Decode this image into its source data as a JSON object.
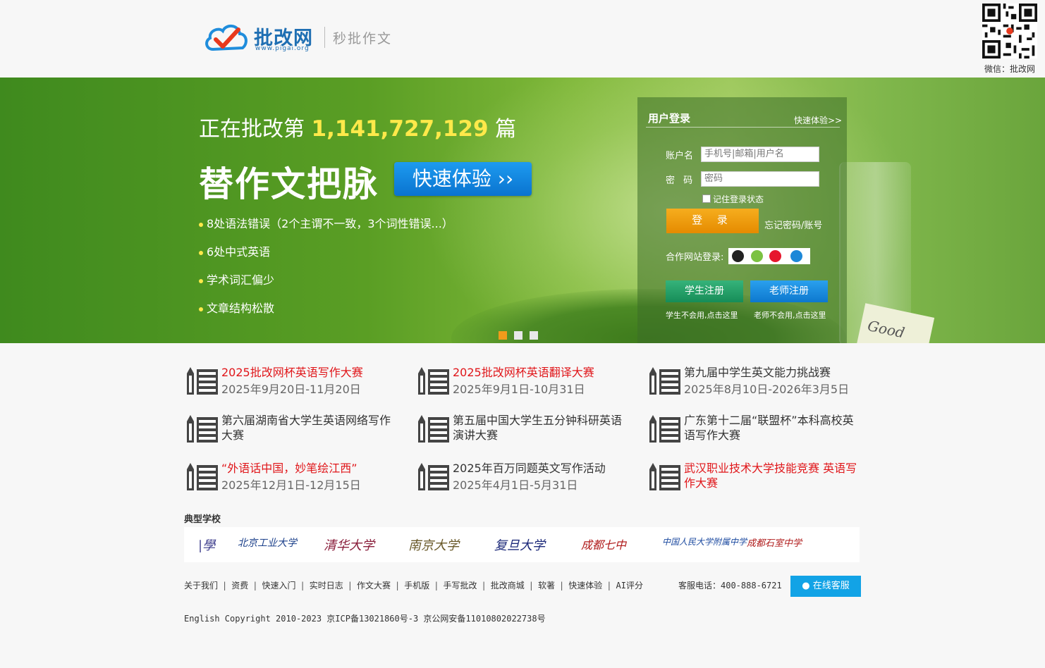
{
  "header": {
    "brand": "批改网",
    "url": "www.pigai.org",
    "slogan": "秒批作文",
    "qr_caption": "微信：批改网"
  },
  "banner": {
    "counter_prefix": "正在批改第",
    "counter_value": "1,141,727,129",
    "counter_suffix": "篇",
    "headline": "替作文把脉",
    "try_button": "快速体验 ››",
    "bullets": [
      "8处语法错误（2个主谓不一致，3个词性错误...）",
      "6处中式英语",
      "学术词汇偏少",
      "文章结构松散"
    ],
    "slide_count": 3,
    "active_slide": 1,
    "card_text": "Good"
  },
  "login": {
    "title": "用户登录",
    "quick_link": "快速体验>>",
    "account_label": "账户名",
    "account_placeholder": "手机号|邮箱|用户名",
    "password_label": "密  码",
    "password_placeholder": "密码",
    "remember_label": "记住登录状态",
    "login_button": "登 录",
    "forgot_link": "忘记密码/账号",
    "partner_label": "合作网站登录:",
    "partner_icons": [
      "qq-icon",
      "wechat-icon",
      "weibo-icon",
      "other-login-icon"
    ],
    "student_register": "学生注册",
    "teacher_register": "老师注册",
    "student_hint": "学生不会用,点击这里",
    "teacher_hint": "老师不会用,点击这里"
  },
  "contests": [
    {
      "name": "2025批改网杯英语写作大赛",
      "date": "2025年9月20日-11月20日",
      "highlight": true
    },
    {
      "name": "2025批改网杯英语翻译大赛",
      "date": "2025年9月1日-10月31日",
      "highlight": true
    },
    {
      "name": "第九届中学生英文能力挑战赛",
      "date": "2025年8月10日-2026年3月5日",
      "highlight": false
    },
    {
      "name": "第六届湖南省大学生英语网络写作大赛",
      "date": "",
      "highlight": false
    },
    {
      "name": "第五届中国大学生五分钟科研英语演讲大赛",
      "date": "",
      "highlight": false
    },
    {
      "name": "广东第十二届“联盟杯”本科高校英语写作大赛",
      "date": "",
      "highlight": false
    },
    {
      "name": "“外语话中国，妙笔绘江西”",
      "date": "2025年12月1日-12月15日",
      "highlight": true
    },
    {
      "name": "2025年百万同题英文写作活动",
      "date": "2025年4月1日-5月31日",
      "highlight": false
    },
    {
      "name": "武汉职业技术大学技能竞赛 英语写作大赛",
      "date": "",
      "highlight": true
    }
  ],
  "schools": {
    "title": "典型学校",
    "items": [
      "北京工业大学",
      "清华大学",
      "南京大学",
      "复旦大学",
      "成都七中",
      "中国人民大学附属中学",
      "成都石室中学"
    ]
  },
  "footer": {
    "links": [
      "关于我们",
      "资费",
      "快速入门",
      "实时日志",
      "作文大赛",
      "手机版",
      "手写批改",
      "批改商城",
      "软著",
      "快速体验",
      "AI评分"
    ],
    "copyright": "English Copyright 2010-2023 京ICP备13021860号-3 京公网安备11010802022738号",
    "hotline": "客服电话：400-888-6721",
    "service_button": "在线客服"
  },
  "colors": {
    "brand_blue": "#1f6fb3",
    "highlight_red": "#e0161a",
    "counter_yellow": "#ffe94a",
    "login_orange": "#f19b1b",
    "student_green": "#168d58",
    "teacher_blue": "#0d78cf",
    "service_blue": "#12a3e6"
  }
}
